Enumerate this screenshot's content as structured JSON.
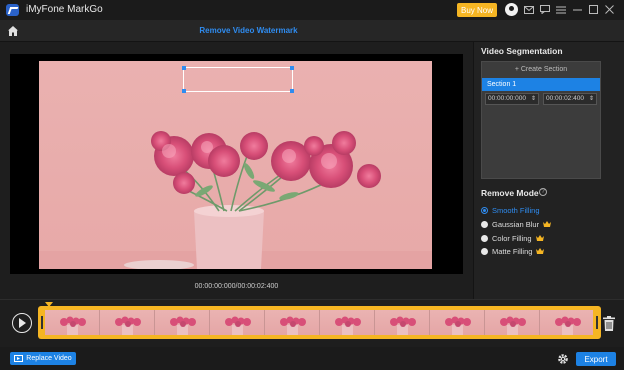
{
  "window": {
    "app_title": "iMyFone MarkGo",
    "buy_label": "Buy Now",
    "controls": [
      "user-icon",
      "mail-icon",
      "chat-icon",
      "menu-icon",
      "minimize-icon",
      "maximize-icon",
      "close-icon"
    ]
  },
  "header": {
    "title": "Remove Video Watermark",
    "home_icon": "home-icon"
  },
  "preview": {
    "timecode": "00:00:00:000/00:00:02:400"
  },
  "segmentation": {
    "title": "Video Segmentation",
    "create_label": "+ Create Section",
    "sections": [
      {
        "label": "Section 1",
        "start": "00:00:00:000",
        "end": "00:00:02:400"
      }
    ]
  },
  "remove_mode": {
    "title": "Remove Mode",
    "options": [
      {
        "label": "Smooth Filling",
        "selected": true,
        "premium": false
      },
      {
        "label": "Gaussian Blur",
        "selected": false,
        "premium": true
      },
      {
        "label": "Color Filling",
        "selected": false,
        "premium": true
      },
      {
        "label": "Matte Filling",
        "selected": false,
        "premium": true
      }
    ]
  },
  "timeline": {
    "thumbnail_count": 10
  },
  "footer": {
    "replace_label": "Replace Video",
    "export_label": "Export"
  },
  "colors": {
    "accent": "#2f8cf0",
    "buy": "#f5b523",
    "button": "#1d82e4",
    "crown": "#f5b523"
  }
}
